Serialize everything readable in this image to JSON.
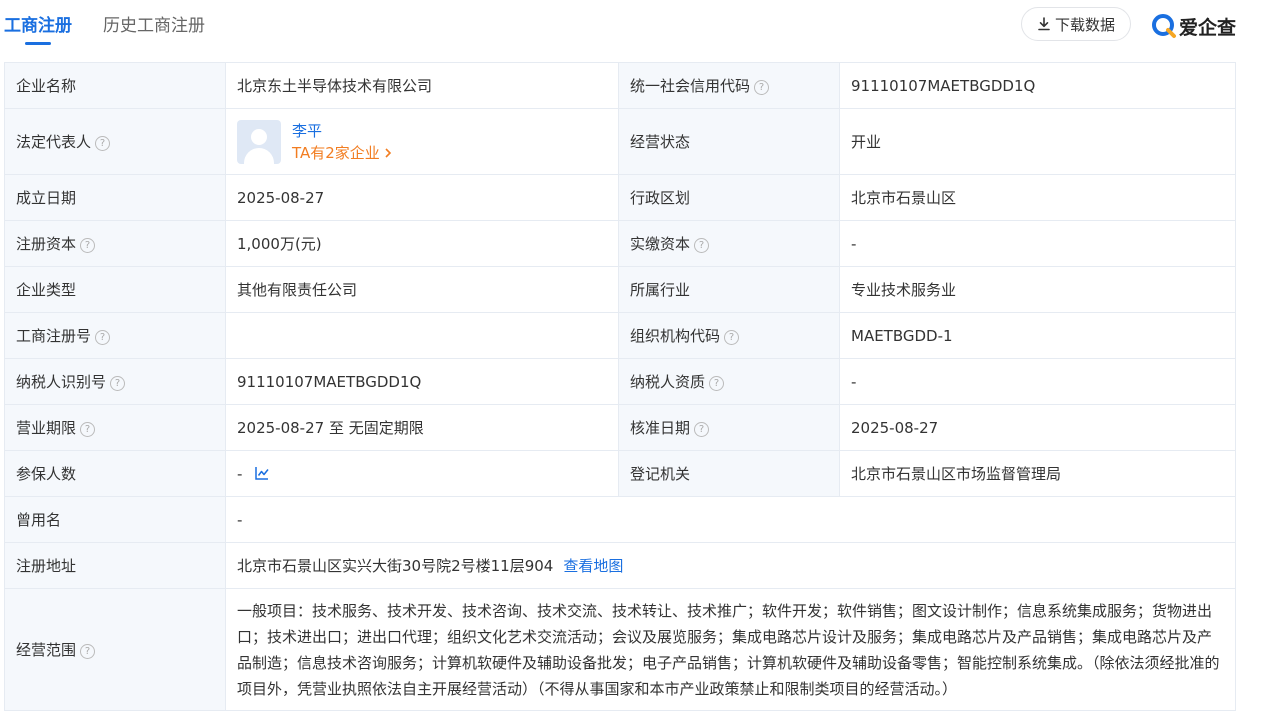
{
  "tabs": {
    "active": "工商注册",
    "inactive": "历史工商注册"
  },
  "toolbar": {
    "download_label": "下载数据"
  },
  "brand": {
    "name": "爱企查"
  },
  "rows": {
    "company_name": {
      "label": "企业名称",
      "value": "北京东土半导体技术有限公司"
    },
    "credit_code": {
      "label": "统一社会信用代码",
      "value": "91110107MAETBGDD1Q"
    },
    "legal_rep": {
      "label": "法定代表人",
      "name": "李平",
      "link": "TA有2家企业"
    },
    "status": {
      "label": "经营状态",
      "value": "开业"
    },
    "founded": {
      "label": "成立日期",
      "value": "2025-08-27"
    },
    "district": {
      "label": "行政区划",
      "value": "北京市石景山区"
    },
    "reg_capital": {
      "label": "注册资本",
      "value": "1,000万(元)"
    },
    "paid_capital": {
      "label": "实缴资本",
      "value": "-"
    },
    "company_type": {
      "label": "企业类型",
      "value": "其他有限责任公司"
    },
    "industry": {
      "label": "所属行业",
      "value": "专业技术服务业"
    },
    "reg_number": {
      "label": "工商注册号",
      "value": ""
    },
    "org_code": {
      "label": "组织机构代码",
      "value": "MAETBGDD-1"
    },
    "taxpayer_id": {
      "label": "纳税人识别号",
      "value": "91110107MAETBGDD1Q"
    },
    "taxpayer_qual": {
      "label": "纳税人资质",
      "value": "-"
    },
    "term": {
      "label": "营业期限",
      "value": "2025-08-27 至 无固定期限"
    },
    "approval_date": {
      "label": "核准日期",
      "value": "2025-08-27"
    },
    "insured": {
      "label": "参保人数",
      "value": "-"
    },
    "authority": {
      "label": "登记机关",
      "value": "北京市石景山区市场监督管理局"
    },
    "former_name": {
      "label": "曾用名",
      "value": "-"
    },
    "address": {
      "label": "注册地址",
      "value": "北京市石景山区实兴大街30号院2号楼11层904",
      "map_link": "查看地图"
    },
    "scope": {
      "label": "经营范围",
      "value": "一般项目：技术服务、技术开发、技术咨询、技术交流、技术转让、技术推广；软件开发；软件销售；图文设计制作；信息系统集成服务；货物进出口；技术进出口；进出口代理；组织文化艺术交流活动；会议及展览服务；集成电路芯片设计及服务；集成电路芯片及产品销售；集成电路芯片及产品制造；信息技术咨询服务；计算机软硬件及辅助设备批发；电子产品销售；计算机软硬件及辅助设备零售；智能控制系统集成。（除依法须经批准的项目外，凭营业执照依法自主开展经营活动）（不得从事国家和本市产业政策禁止和限制类项目的经营活动。）"
    }
  },
  "help_glyph": "?",
  "colors": {
    "accent": "#1a6fe0",
    "link_orange": "#f27d21",
    "label_bg": "#f5f8fc",
    "border": "#e6ebf2"
  }
}
